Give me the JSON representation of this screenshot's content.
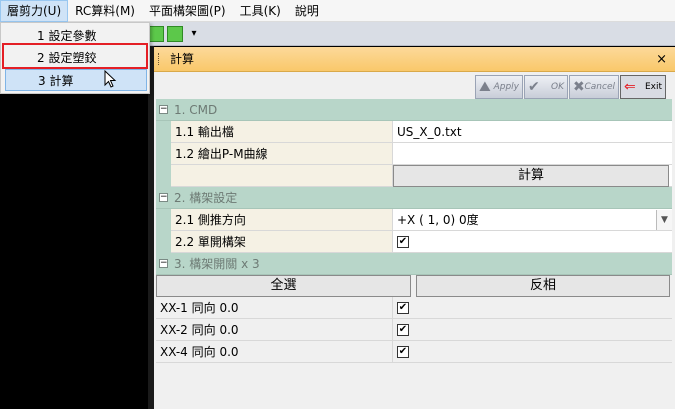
{
  "menubar": {
    "items": [
      "層剪力(U)",
      "RC算料(M)",
      "平面構架圖(P)",
      "工具(K)",
      "說明"
    ]
  },
  "dropdown": {
    "items": [
      "1 設定參數",
      "2 設定塑鉸",
      "3 計算"
    ],
    "selected_index": 2
  },
  "window": {
    "title": "計算",
    "close_glyph": "×"
  },
  "toolbar_buttons": {
    "apply": "Apply",
    "ok": "OK",
    "cancel": "Cancel",
    "exit": "Exit"
  },
  "grid": {
    "cat1": {
      "expander": "−",
      "label": "1. CMD"
    },
    "row_1_1": {
      "name": "1.1 輸出檔",
      "value": "US_X_0.txt"
    },
    "row_1_2": {
      "name": "1.2 繪出P-M曲線",
      "value": ""
    },
    "calc_button": "計算",
    "cat2": {
      "expander": "−",
      "label": "2. 構架設定"
    },
    "row_2_1": {
      "name": "2.1 側推方向",
      "value": "+X ( 1, 0)   0度"
    },
    "row_2_2": {
      "name": "2.2 單開構架",
      "checked": true
    },
    "cat3": {
      "expander": "−",
      "label": "3. 構架開關 x 3"
    },
    "select_all": "全選",
    "invert": "反相",
    "frames": [
      {
        "name": "XX-1 同向 0.0",
        "checked": true
      },
      {
        "name": "XX-2 同向 0.0",
        "checked": true
      },
      {
        "name": "XX-4 同向 0.0",
        "checked": true
      }
    ]
  },
  "colors": {
    "title_bar": "#f9c86a",
    "category_bg": "#b8d6c9",
    "highlight_border": "#e41f26"
  }
}
